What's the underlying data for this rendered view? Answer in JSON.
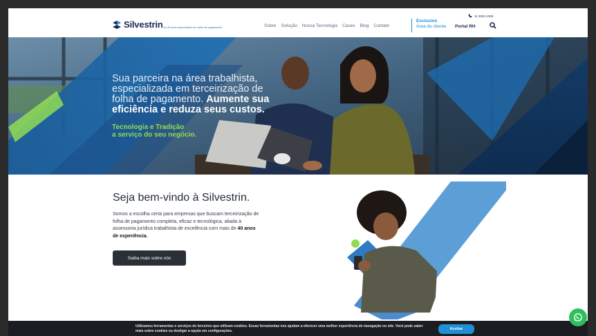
{
  "header": {
    "brand": "Silvestrin",
    "tagline": "há 40 anos especialista em folha de pagamento",
    "nav": [
      "Sobre",
      "Solução",
      "Nossa Tecnologia",
      "Cases",
      "Blog",
      "Contato"
    ],
    "exclusive_label": "Exclusivo",
    "client_area_label": "Área do cliente",
    "portal_label": "Portal RH",
    "phone": "11 3052-1085"
  },
  "hero": {
    "line_light": "Sua parceira na área trabalhista, especializada em terceirização de folha de pagamento.",
    "line_strong": "Aumente sua eficiência e reduza seus custos.",
    "green_line_1": "Tecnologia e Tradição",
    "green_line_2": "a serviço do seu negócio."
  },
  "welcome": {
    "title": "Seja bem-vindo à Silvestrin.",
    "body": "Somos a escolha certa para empresas que buscam terceirização de folha de pagamento completa, eficaz e tecnológica, aliada à assessoria jurídica trabalhista de excelência com mais de",
    "body_bold": "40 anos de experiência.",
    "cta_label": "Saiba mais sobre nós"
  },
  "cookie": {
    "text": "Utilizamos ferramentas e serviços de terceiros que utilizam cookies. Essas ferramentas nos ajudam a oferecer uma melhor experiência de navegação no site. Você pode saber mais sobre cookies ou desligar a opção em configurações.",
    "accept_label": "Aceitar"
  },
  "colors": {
    "brand_navy": "#1d2a55",
    "accent_blue": "#1f8fd6",
    "accent_green": "#8fdc55",
    "whatsapp_green": "#2fbf5b"
  },
  "icons": [
    "phone-icon",
    "search-icon",
    "whatsapp-icon",
    "silvestrin-logo"
  ]
}
